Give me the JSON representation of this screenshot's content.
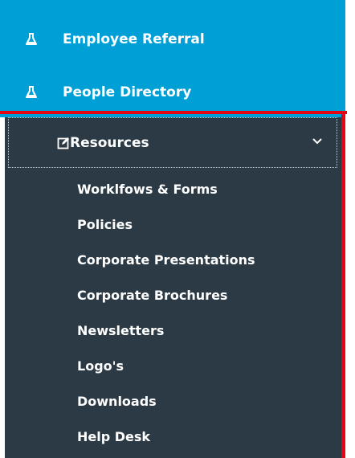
{
  "colors": {
    "blue_nav": "#00a0d6",
    "dark_panel": "#2b3a44",
    "highlight_border": "#e30613",
    "text": "#ffffff"
  },
  "nav": {
    "top_items": [
      {
        "label": "Employee Referral",
        "icon": "flask-icon"
      },
      {
        "label": "People Directory",
        "icon": "flask-icon"
      }
    ],
    "resources": {
      "label": "Resources",
      "icon": "edit-icon",
      "toggle_icon": "chevron-down-icon",
      "submenu": [
        "Worklfows & Forms",
        "Policies",
        "Corporate Presentations",
        "Corporate Brochures",
        "Newsletters",
        "Logo's",
        "Downloads",
        "Help Desk"
      ]
    }
  }
}
